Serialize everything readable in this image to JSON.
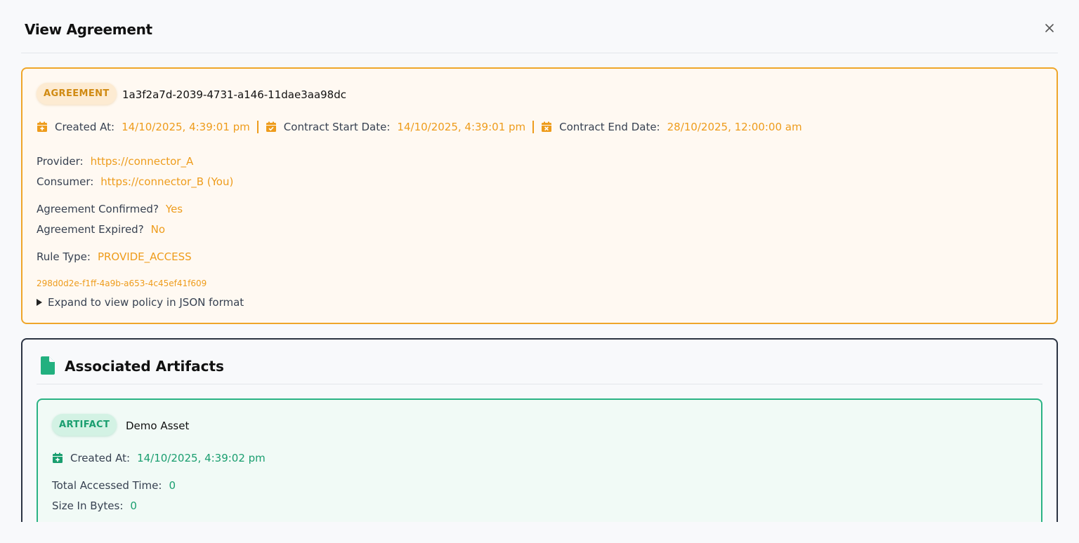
{
  "modal": {
    "title": "View Agreement",
    "close_label": "×"
  },
  "agreement": {
    "badge": "AGREEMENT",
    "id": "1a3f2a7d-2039-4731-a146-11dae3aa98dc",
    "created_label": "Created At:",
    "created_value": "14/10/2025, 4:39:01 pm",
    "start_label": "Contract Start Date:",
    "start_value": "14/10/2025, 4:39:01 pm",
    "end_label": "Contract End Date:",
    "end_value": "28/10/2025, 12:00:00 am",
    "provider_label": "Provider:",
    "provider_value": "https://connector_A",
    "consumer_label": "Consumer:",
    "consumer_value": "https://connector_B (You)",
    "confirmed_label": "Agreement Confirmed?",
    "confirmed_value": "Yes",
    "expired_label": "Agreement Expired?",
    "expired_value": "No",
    "rule_label": "Rule Type:",
    "rule_value": "PROVIDE_ACCESS",
    "rule_id": "298d0d2e-f1ff-4a9b-a653-4c45ef41f609",
    "expand_label": "Expand to view policy in JSON format"
  },
  "artifacts": {
    "title": "Associated Artifacts",
    "items": [
      {
        "badge": "ARTIFACT",
        "name": "Demo Asset",
        "created_label": "Created At:",
        "created_value": "14/10/2025, 4:39:02 pm",
        "accessed_label": "Total Accessed Time:",
        "accessed_value": "0",
        "size_label": "Size In Bytes:",
        "size_value": "0"
      }
    ]
  },
  "colors": {
    "agreement_accent": "#ee9c1c",
    "artifact_accent": "#1a9e6f",
    "artifacts_border": "#2b3342"
  },
  "icons": {
    "close": "close-icon",
    "calendar_plus": "calendar-plus-icon",
    "calendar_check": "calendar-check-icon",
    "calendar_x": "calendar-x-icon",
    "document": "document-icon",
    "expand": "triangle-right-icon"
  }
}
